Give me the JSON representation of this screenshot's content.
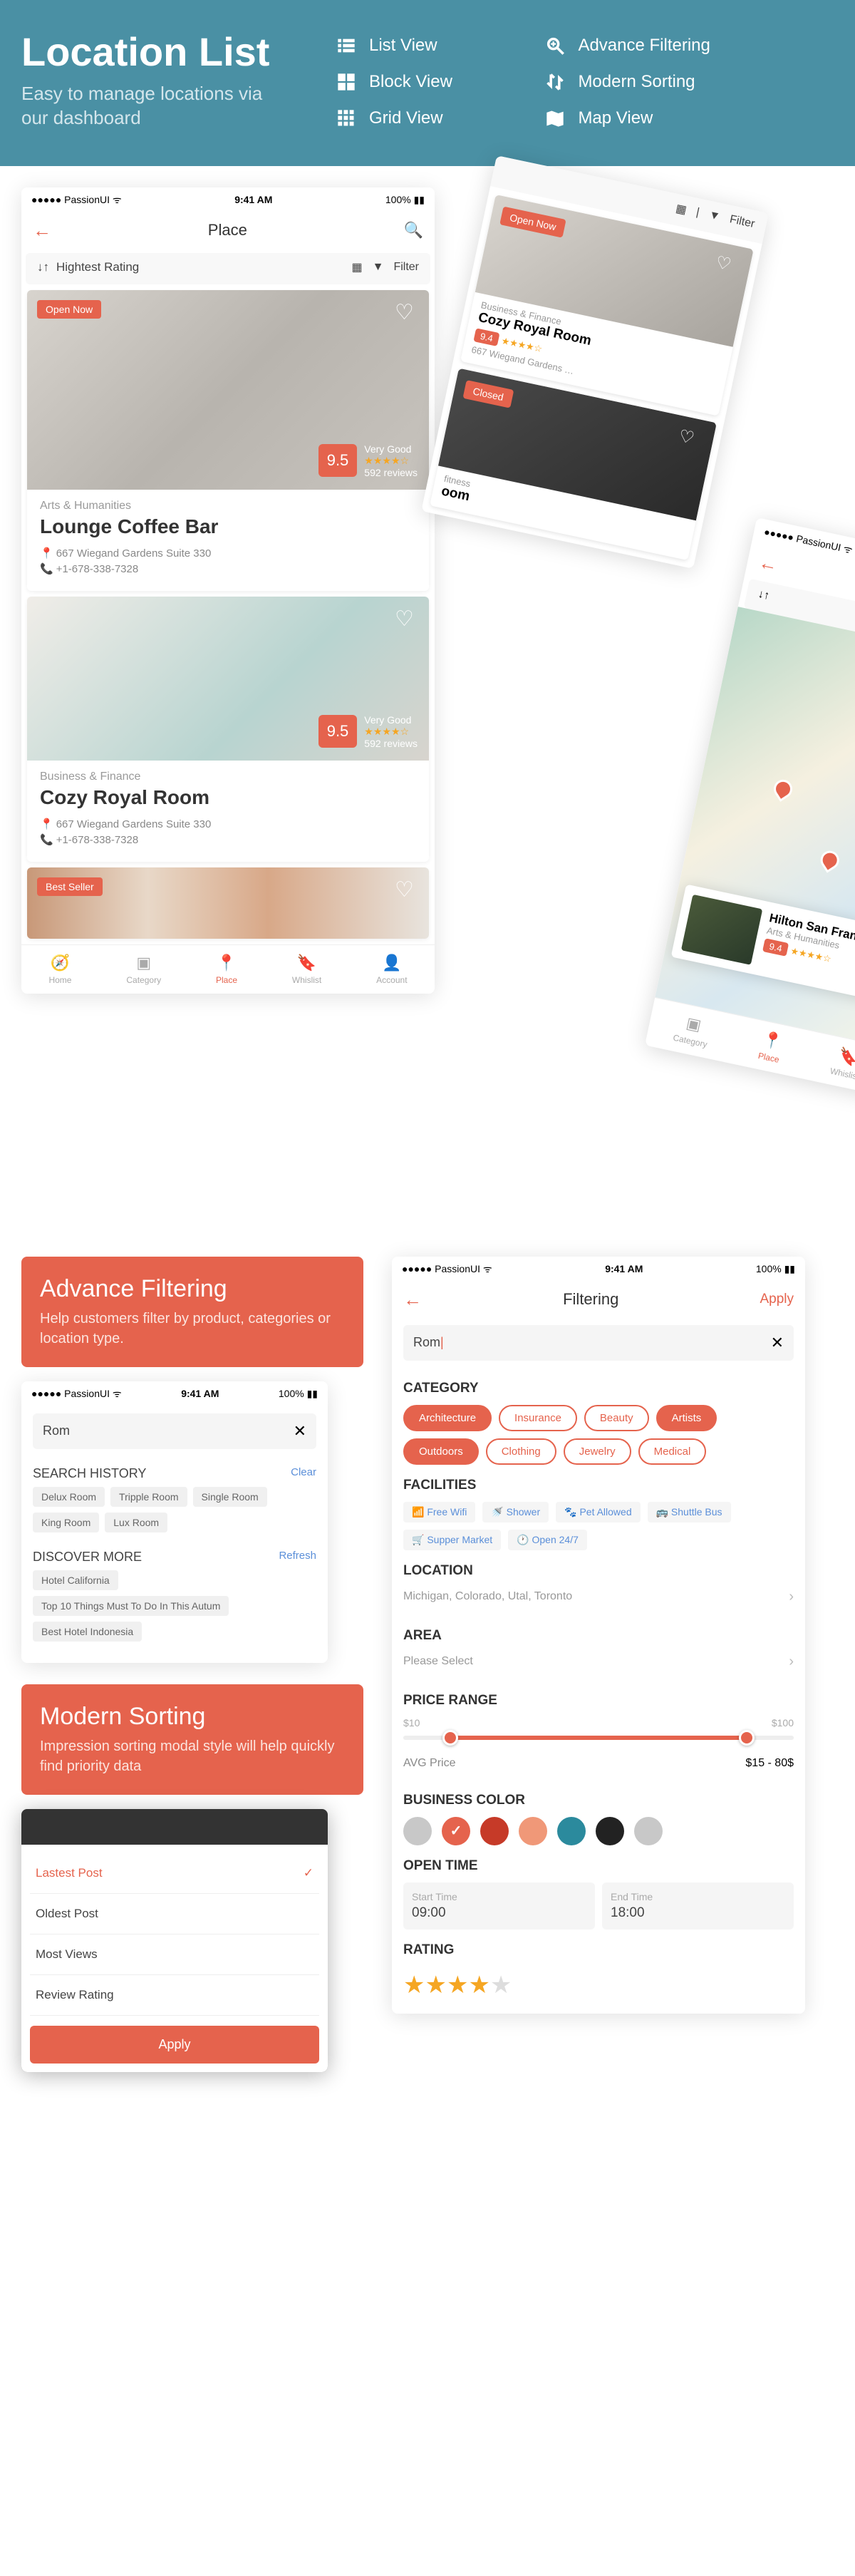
{
  "hero": {
    "title": "Location List",
    "subtitle": "Easy to manage locations via our dashboard",
    "items": [
      "List View",
      "Block View",
      "Grid View",
      "Advance Filtering",
      "Modern Sorting",
      "Map View"
    ]
  },
  "status": {
    "carrier": "●●●●● PassionUI ᯤ",
    "time": "9:41 AM",
    "battery": "100% ▮▮"
  },
  "place": {
    "title": "Place",
    "sort_label": "Hightest Rating",
    "filter_label": "Filter",
    "cards": [
      {
        "badge": "Open Now",
        "rating": "9.5",
        "rating_text": "Very Good",
        "reviews": "592 reviews",
        "category": "Arts & Humanities",
        "title": "Lounge Coffee Bar",
        "address": "667 Wiegand Gardens Suite 330",
        "phone": "+1-678-338-7328"
      },
      {
        "badge": "",
        "rating": "9.5",
        "rating_text": "Very Good",
        "reviews": "592 reviews",
        "category": "Business & Finance",
        "title": "Cozy Royal Room",
        "address": "667 Wiegand Gardens Suite 330",
        "phone": "+1-678-338-7328"
      },
      {
        "badge": "Best Seller"
      }
    ],
    "tabs": [
      "Home",
      "Category",
      "Place",
      "Whislist",
      "Account"
    ]
  },
  "angled": {
    "filter": "Filter",
    "card1": {
      "badge": "Open Now",
      "category": "Business & Finance",
      "title": "Cozy Royal Room",
      "score": "9.4",
      "addr": "667 Wiegand Gardens …"
    },
    "card2": {
      "badge": "Closed",
      "category": "fitness",
      "title": "oom"
    }
  },
  "map": {
    "card": {
      "title": "Hilton San Francisco",
      "category": "Arts & Humanities",
      "score": "9.4"
    },
    "tabs": [
      "Category",
      "Place",
      "Whislist"
    ]
  },
  "adv_filter": {
    "title": "Advance Filtering",
    "desc": "Help customers filter by product, categories or location type."
  },
  "search": {
    "value": "Rom",
    "history_title": "SEARCH HISTORY",
    "clear": "Clear",
    "history": [
      "Delux Room",
      "Tripple Room",
      "Single Room",
      "King Room",
      "Lux Room"
    ],
    "discover_title": "DISCOVER MORE",
    "refresh": "Refresh",
    "discover": [
      "Hotel California",
      "Top 10 Things Must To Do In This Autum",
      "Best Hotel Indonesia"
    ]
  },
  "modern_sort": {
    "title": "Modern Sorting",
    "desc": "Impression sorting modal style will help quickly find priority data"
  },
  "sort": {
    "items": [
      "Lastest Post",
      "Oldest Post",
      "Most Views",
      "Review Rating"
    ],
    "apply": "Apply"
  },
  "filtering": {
    "title": "Filtering",
    "apply": "Apply",
    "search": "Rom",
    "category_title": "CATEGORY",
    "categories": [
      {
        "label": "Architecture",
        "on": true
      },
      {
        "label": "Insurance",
        "on": false
      },
      {
        "label": "Beauty",
        "on": false
      },
      {
        "label": "Artists",
        "on": true
      },
      {
        "label": "Outdoors",
        "on": true
      },
      {
        "label": "Clothing",
        "on": false
      },
      {
        "label": "Jewelry",
        "on": false
      },
      {
        "label": "Medical",
        "on": false
      }
    ],
    "facilities_title": "FACILITIES",
    "facilities": [
      "Free Wifi",
      "Shower",
      "Pet Allowed",
      "Shuttle Bus",
      "Supper Market",
      "Open 24/7"
    ],
    "location_title": "LOCATION",
    "location_value": "Michigan, Colorado, Utal, Toronto",
    "area_title": "AREA",
    "area_value": "Please Select",
    "price_title": "PRICE RANGE",
    "price_min": "$10",
    "price_max": "$100",
    "avg_label": "AVG Price",
    "avg_value": "$15 - 80$",
    "color_title": "BUSINESS COLOR",
    "colors": [
      "#c8c8c8",
      "#e5634d",
      "#c63a28",
      "#f09878",
      "#2b8a9d",
      "#222",
      "#c8c8c8"
    ],
    "time_title": "OPEN TIME",
    "start_label": "Start Time",
    "start_val": "09:00",
    "end_label": "End Time",
    "end_val": "18:00",
    "rating_title": "RATING"
  }
}
